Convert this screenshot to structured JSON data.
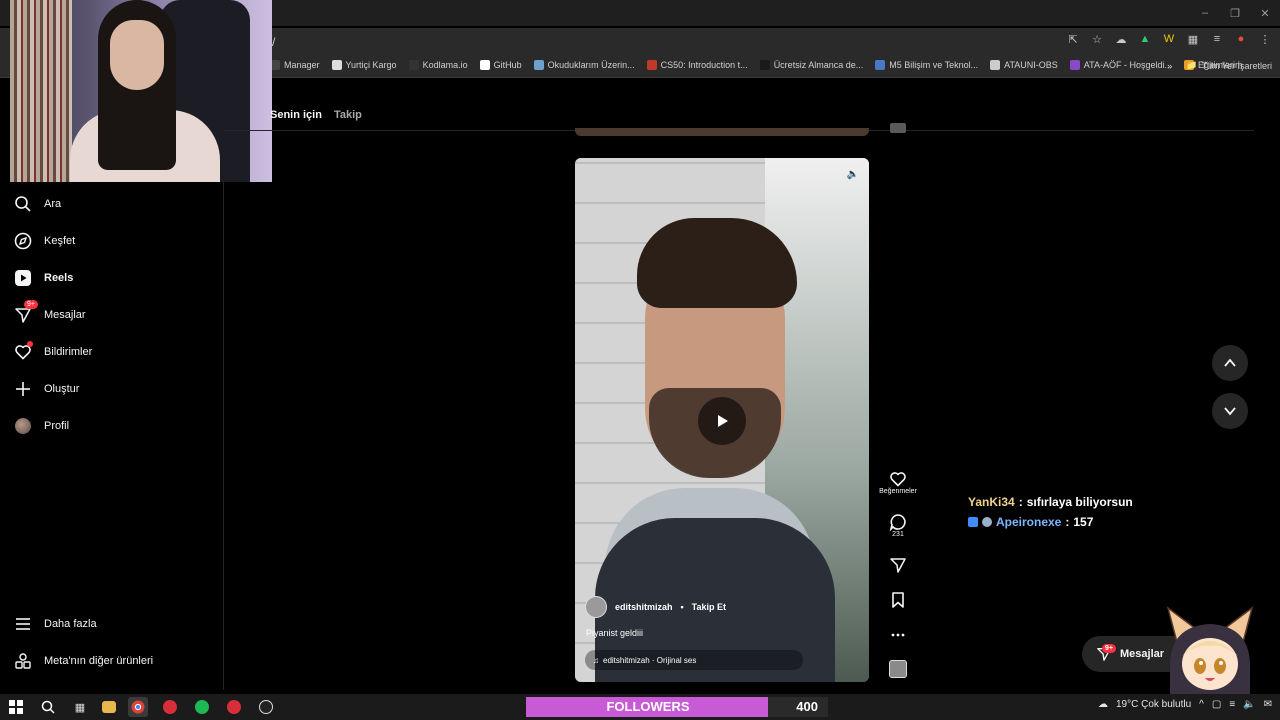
{
  "browser": {
    "url_fragment": "/",
    "bookmarks": [
      {
        "label": "Manager",
        "color": "#444444"
      },
      {
        "label": "Yurtiçi Kargo",
        "color": "#dddddd"
      },
      {
        "label": "Kodlama.io",
        "color": "#333333"
      },
      {
        "label": "GitHub",
        "color": "#ffffff"
      },
      {
        "label": "Okuduklarım Üzerin...",
        "color": "#6fa0c8"
      },
      {
        "label": "CS50: Introduction t...",
        "color": "#c0392b"
      },
      {
        "label": "Ücretsiz Almanca de...",
        "color": "#1a1a1a"
      },
      {
        "label": "M5 Bilişim ve Teknol...",
        "color": "#4a78c8"
      },
      {
        "label": "ATAUNI-OBS",
        "color": "#cccccc"
      },
      {
        "label": "ATA-AÖF - Hoşgeldi...",
        "color": "#8a4ac8"
      },
      {
        "label": "Eğitimlerim",
        "color": "#e8a020"
      }
    ],
    "bookmarks_more": "»",
    "all_bookmarks": "Tüm Yer İşaretleri"
  },
  "sidebar": {
    "items": [
      {
        "label": "Ara",
        "icon": "search-icon",
        "bold": false
      },
      {
        "label": "Keşfet",
        "icon": "compass-icon",
        "bold": false
      },
      {
        "label": "Reels",
        "icon": "reels-icon",
        "bold": true
      },
      {
        "label": "Mesajlar",
        "icon": "messenger-icon",
        "bold": false,
        "badge": "9+"
      },
      {
        "label": "Bildirimler",
        "icon": "heart-icon",
        "bold": false,
        "dot": true
      },
      {
        "label": "Oluştur",
        "icon": "plus-icon",
        "bold": false
      },
      {
        "label": "Profil",
        "icon": "avatar",
        "bold": false
      }
    ],
    "more_label": "Daha fazla",
    "meta_label": "Meta'nın diğer ürünleri"
  },
  "feed_tabs": {
    "for_you": "Senin için",
    "following": "Takip"
  },
  "reel": {
    "username": "editshitmizah",
    "separator": "•",
    "follow_label": "Takip Et",
    "caption": "Piyanist geldiii",
    "audio": "editshitmizah · Orijinal ses",
    "likes_label": "Beğenmeler",
    "comments_count": "231"
  },
  "chat": {
    "messages": [
      {
        "user": "YanKi34",
        "sep": ":",
        "text": "sıfırlaya biliyorsun"
      },
      {
        "user": "Apeironexe",
        "sep": ":",
        "text": "157"
      }
    ]
  },
  "messages_pill": {
    "label": "Mesajlar",
    "badge": "9+"
  },
  "overlay": {
    "followers_label": "FOLLOWERS",
    "followers_count": "400",
    "followers_progress": 0.8
  },
  "taskbar": {
    "weather": "19°C  Çok bulutlu"
  },
  "colors": {
    "accent_red": "#ff3040",
    "followers_fill": "#c95ad6",
    "chat_user1": "#f0d38a",
    "chat_user2": "#7fb6ff"
  }
}
